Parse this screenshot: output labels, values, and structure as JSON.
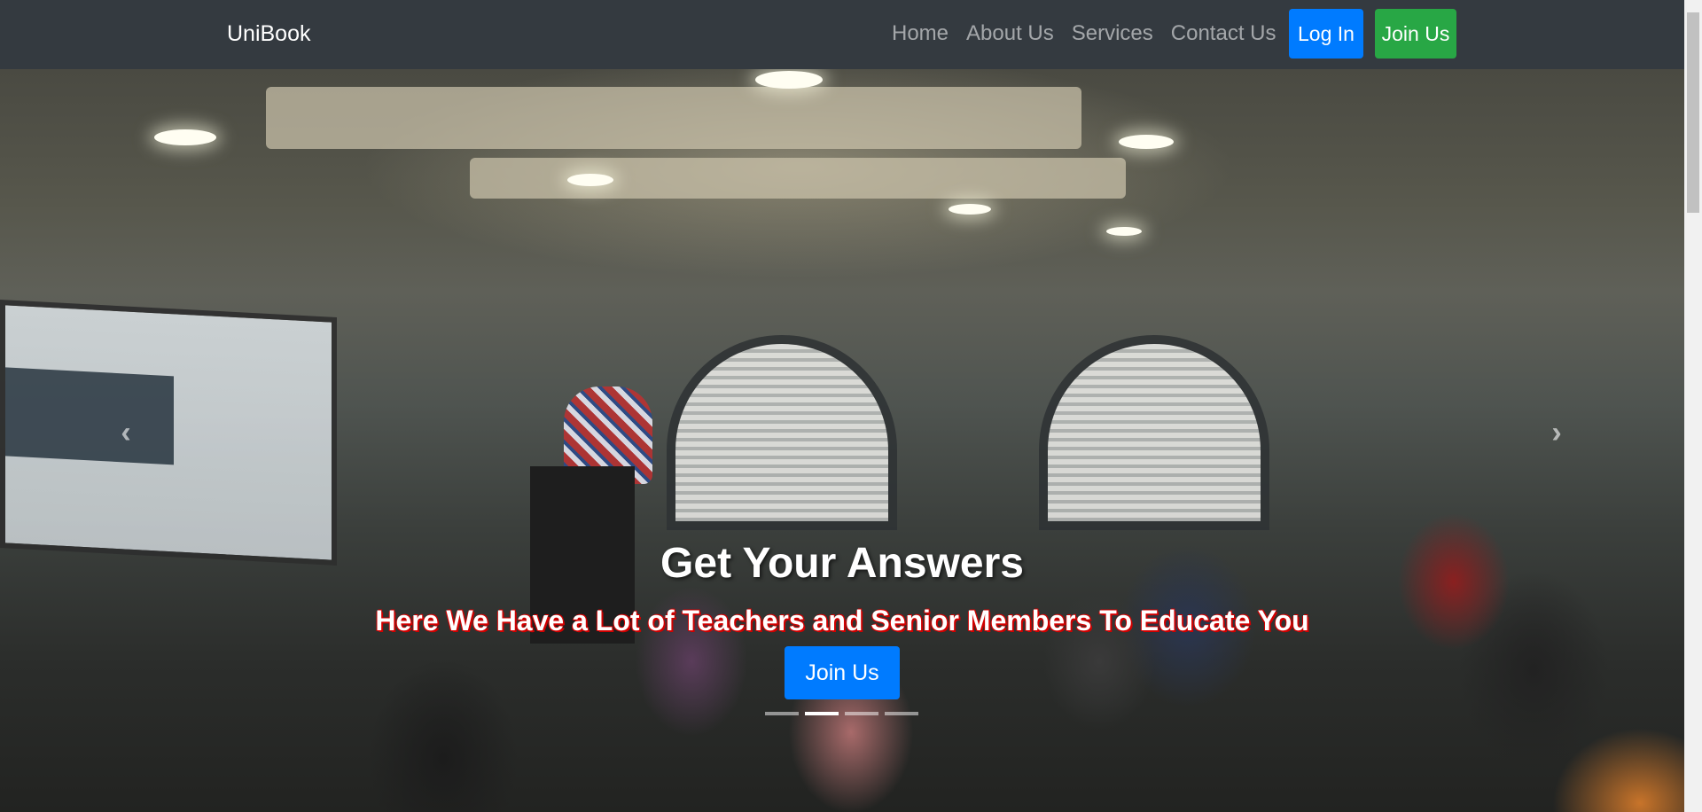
{
  "navbar": {
    "brand": "UniBook",
    "links": [
      "Home",
      "About Us",
      "Services",
      "Contact Us"
    ],
    "login_label": "Log In",
    "join_label": "Join Us",
    "bg_color": "#343a40",
    "login_color": "#007bff",
    "join_color": "#28a745"
  },
  "hero": {
    "title": "Get Your Answers",
    "subtitle": "Here We Have a Lot of Teachers and Senior Members To Educate You",
    "button_label": "Join Us",
    "prev_icon": "‹",
    "next_icon": "›",
    "indicators": 4,
    "active_indicator": 2
  }
}
